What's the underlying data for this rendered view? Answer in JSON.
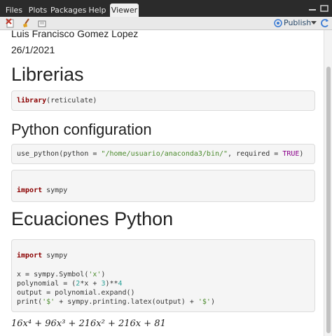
{
  "tabs": [
    "Files",
    "Plots",
    "Packages",
    "Help",
    "Viewer"
  ],
  "active_tab": "Viewer",
  "toolbar": {
    "publish_label": "Publish"
  },
  "doc": {
    "author": "Luis Francisco Gomez Lopez",
    "date": "26/1/2021",
    "sections": [
      {
        "title": "Librerias"
      },
      {
        "title": "Python configuration"
      },
      {
        "title": "Ecuaciones Python"
      }
    ],
    "code": {
      "library_kw": "library",
      "library_arg": "(reticulate)",
      "use_python_1": "use_python(python = ",
      "use_python_path": "\"/home/usuario/anaconda3/bin/\"",
      "use_python_2": ", required = ",
      "use_python_true": "TRUE",
      "use_python_3": ")",
      "import_kw": "import",
      "import_mod": " sympy",
      "import_kw_2": "import",
      "import_mod_2": " sympy",
      "sym_line_1": "x = sympy.Symbol(",
      "sym_line_str": "'x'",
      "sym_line_2": ")",
      "poly_1": "polynomial = (",
      "poly_2": "2",
      "poly_3": "*x + ",
      "poly_4": "3",
      "poly_5": ")**",
      "poly_6": "4",
      "expand_line": "output = polynomial.expand()",
      "print_1": "print(",
      "print_2": "'$'",
      "print_3": " + sympy.printing.latex(output) + ",
      "print_4": "'$'",
      "print_5": ")"
    },
    "output_math": "16x⁴ + 96x³ + 216x² + 216x + 81"
  }
}
